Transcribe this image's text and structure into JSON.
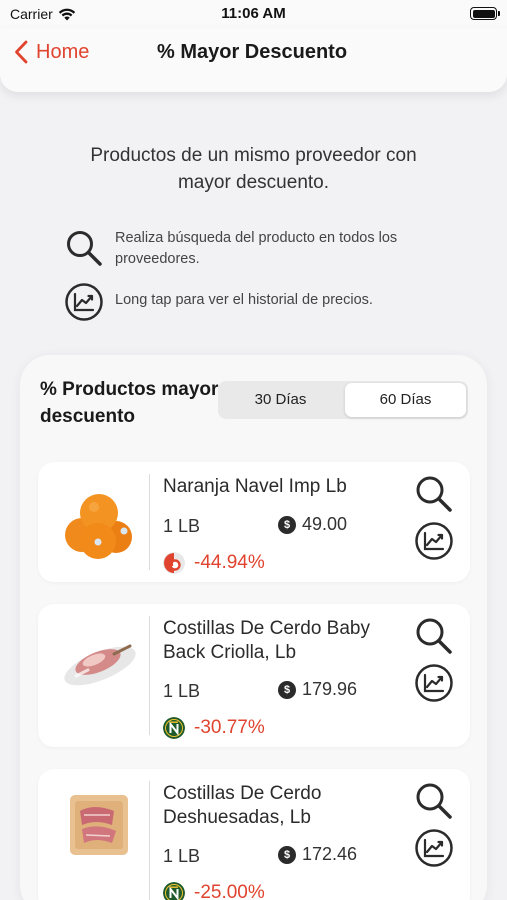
{
  "status_bar": {
    "carrier": "Carrier",
    "time": "11:06 AM"
  },
  "nav": {
    "back_label": "Home",
    "title": "% Mayor Descuento"
  },
  "intro": {
    "line1": "Productos de un mismo proveedor con",
    "line2": "mayor descuento.",
    "hints": [
      {
        "icon": "search-icon",
        "text": "Realiza búsqueda del producto en todos los proveedores."
      },
      {
        "icon": "chart-icon",
        "text": "Long tap para ver el historial de precios."
      }
    ]
  },
  "panel": {
    "title": "% Productos mayor descuento",
    "segments": [
      "30 Días",
      "60 Días"
    ],
    "selected_segment": "60 Días",
    "products": [
      {
        "name": "Naranja Navel Imp Lb",
        "unit": "1 LB",
        "price": "49.00",
        "discount": "-44.94%",
        "vendor": "vendor-b-logo"
      },
      {
        "name": "Costillas De Cerdo Baby Back Criolla, Lb",
        "unit": "1 LB",
        "price": "179.96",
        "discount": "-30.77%",
        "vendor": "vendor-n-logo"
      },
      {
        "name": "Costillas De Cerdo Deshuesadas, Lb",
        "unit": "1 LB",
        "price": "172.46",
        "discount": "-25.00%",
        "vendor": "vendor-n-logo"
      }
    ]
  },
  "colors": {
    "accent": "#e0442f",
    "background": "#f2f2f4",
    "card": "#ffffff"
  }
}
